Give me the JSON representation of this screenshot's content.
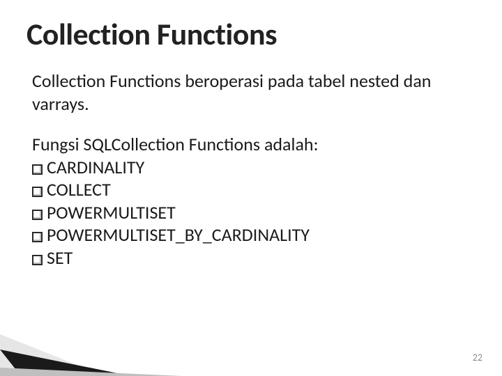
{
  "title": "Collection Functions",
  "paragraph": "Collection Functions beroperasi pada tabel nested dan varrays.",
  "list_intro": "Fungsi SQLCollection Functions adalah:",
  "items": [
    "CARDINALITY",
    "COLLECT",
    "POWERMULTISET",
    "POWERMULTISET_BY_CARDINALITY",
    "SET"
  ],
  "page_number": "22"
}
